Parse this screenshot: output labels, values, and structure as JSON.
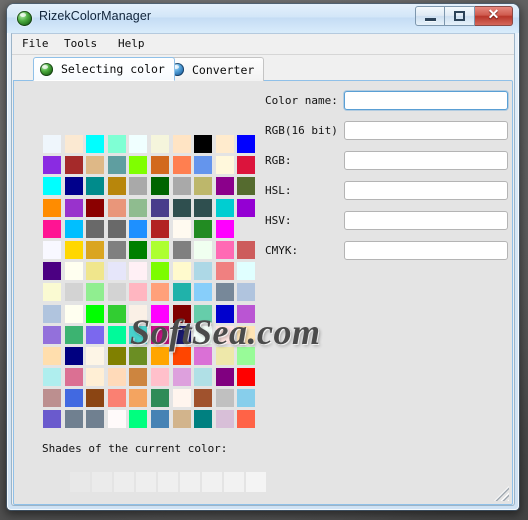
{
  "window": {
    "title": "RizekColorManager",
    "icon": "app-globe-green-icon",
    "controls": {
      "minimize": "–",
      "maximize": "□",
      "close": "✕"
    }
  },
  "menubar": {
    "items": [
      {
        "label": "File"
      },
      {
        "label": "Tools"
      },
      {
        "label": "Help"
      }
    ]
  },
  "tabs": [
    {
      "label": "Selecting color",
      "icon": "globe-green-icon",
      "active": true
    },
    {
      "label": "Converter",
      "icon": "globe-blue-icon",
      "active": false
    }
  ],
  "form": {
    "fields": [
      {
        "label": "Color name:",
        "value": "",
        "placeholder": "",
        "focused": true
      },
      {
        "label": "RGB(16 bit)",
        "value": "",
        "placeholder": "",
        "focused": false
      },
      {
        "label": "RGB:",
        "value": "",
        "placeholder": "",
        "focused": false
      },
      {
        "label": "HSL:",
        "value": "",
        "placeholder": "",
        "focused": false
      },
      {
        "label": "HSV:",
        "value": "",
        "placeholder": "",
        "focused": false
      },
      {
        "label": "CMYK:",
        "value": "",
        "placeholder": "",
        "focused": false
      }
    ]
  },
  "shades": {
    "label": "Shades of the current color:",
    "swatches": [
      "#e8e8e8",
      "#ebebeb",
      "#ededed",
      "#eeeeee",
      "#efefef",
      "#f0f0f0",
      "#f1f1f1",
      "#f2f2f2",
      "#f4f4f4"
    ]
  },
  "watermark": {
    "text": "SoftSea.com"
  },
  "color_grid": {
    "columns": 10,
    "rows": 14,
    "colors": [
      [
        "#eff6fc",
        "#fbe9d2",
        "#00ffff",
        "#7fffd4",
        "#f0ffff",
        "#f5f5dc",
        "#ffe4c4",
        "#000000",
        "#ffebcd",
        "#0000ff"
      ],
      [
        "#8a2be2",
        "#a52a2a",
        "#deb887",
        "#5f9ea0",
        "#7fff00",
        "#d2691e",
        "#ff7f50",
        "#6495ed",
        "#fff8dc",
        "#dc143c"
      ],
      [
        "#00ffff",
        "#00008b",
        "#008b8b",
        "#b8860b",
        "#a9a9a9",
        "#006400",
        "#a9a9a9",
        "#bdb76b",
        "#8b008b",
        "#556b2f"
      ],
      [
        "#ff8c00",
        "#9932cc",
        "#8b0000",
        "#e9967a",
        "#8fbc8f",
        "#483d8b",
        "#2f4f4f",
        "#2f4f4f",
        "#00ced1",
        "#9400d3"
      ],
      [
        "#ff1493",
        "#00bfff",
        "#696969",
        "#696969",
        "#1e90ff",
        "#b22222",
        "#fffaf0",
        "#228b22",
        "#ff00ff",
        ""
      ],
      [
        "#f8f8ff",
        "#ffd700",
        "#daa520",
        "#808080",
        "#008000",
        "#adff2f",
        "#808080",
        "#f0fff0",
        "#ff69b4",
        "#cd5c5c"
      ],
      [
        "#4b0082",
        "#fffff0",
        "#f0e68c",
        "#e6e6fa",
        "#fff0f5",
        "#7cfc00",
        "#fffacd",
        "#add8e6",
        "#f08080",
        "#e0ffff"
      ],
      [
        "#fafad2",
        "#d3d3d3",
        "#90ee90",
        "#d3d3d3",
        "#ffb6c1",
        "#ffa07a",
        "#20b2aa",
        "#87cefa",
        "#778899",
        "#b0c4de"
      ],
      [
        "#b0c4de",
        "#fffff0",
        "#00ff00",
        "#32cd32",
        "#faf0e6",
        "#ff00ff",
        "#800000",
        "#66cdaa",
        "#0000cd",
        "#ba55d3"
      ],
      [
        "#9370db",
        "#3cb371",
        "#7b68ee",
        "#00fa9a",
        "#48d1cc",
        "#c71585",
        "#191970",
        "#f5fffa",
        "#ffe4e1",
        "#ffe4b5"
      ],
      [
        "#ffdead",
        "#000080",
        "#fdf5e6",
        "#808000",
        "#6b8e23",
        "#ffa500",
        "#ff4500",
        "#da70d6",
        "#eee8aa",
        "#98fb98"
      ],
      [
        "#afeeee",
        "#db7093",
        "#ffefd5",
        "#ffdab9",
        "#cd853f",
        "#ffc0cb",
        "#dda0dd",
        "#b0e0e6",
        "#800080",
        "#ff0000"
      ],
      [
        "#bc8f8f",
        "#4169e1",
        "#8b4513",
        "#fa8072",
        "#f4a460",
        "#2e8b57",
        "#fff5ee",
        "#a0522d",
        "#c0c0c0",
        "#87ceeb"
      ],
      [
        "#6a5acd",
        "#708090",
        "#708090",
        "#fffafa",
        "#00ff7f",
        "#4682b4",
        "#d2b48c",
        "#008080",
        "#d8bfd8",
        "#ff6347"
      ]
    ]
  }
}
